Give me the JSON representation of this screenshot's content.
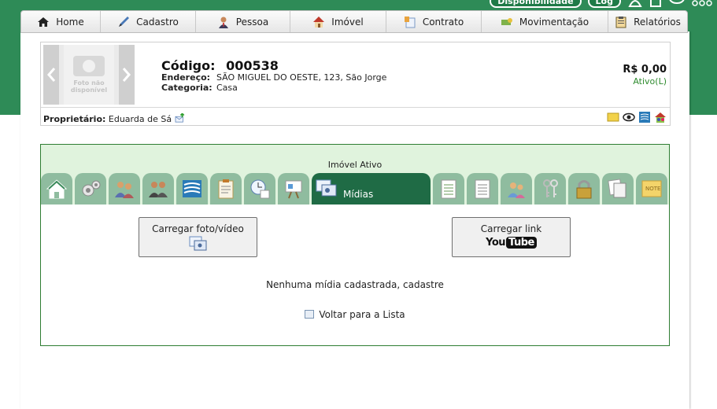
{
  "header": {
    "disponibilidade_label": "Disponibilidade",
    "log_label": "Log"
  },
  "nav": {
    "items": [
      {
        "label": "Home",
        "icon": "home-icon"
      },
      {
        "label": "Cadastro",
        "icon": "pen-icon"
      },
      {
        "label": "Pessoa",
        "icon": "person-icon"
      },
      {
        "label": "Imóvel",
        "icon": "house-icon"
      },
      {
        "label": "Contrato",
        "icon": "contract-icon"
      },
      {
        "label": "Movimentação",
        "icon": "money-icon"
      },
      {
        "label": "Relatórios",
        "icon": "clipboard-icon"
      }
    ]
  },
  "property": {
    "photo_placeholder": "Foto não disponível",
    "codigo_label": "Código:",
    "codigo_value": "000538",
    "endereco_label": "Endereço:",
    "endereco_value": "SÃO MIGUEL DO OESTE, 123, São Jorge",
    "categoria_label": "Categoria:",
    "categoria_value": "Casa",
    "price": "R$ 0,00",
    "status": "Ativo(L)",
    "owner_label": "Proprietário:",
    "owner_value": "Eduarda de Sá"
  },
  "section": {
    "title": "Imóvel Ativo",
    "active_tab_label": "Mídias",
    "upload_media_label": "Carregar foto/vídeo",
    "upload_link_label": "Carregar link",
    "youtube_you": "You",
    "youtube_tube": "Tube",
    "empty_message": "Nenhuma mídia cadastrada, cadastre",
    "back_label": "Voltar para a Lista"
  },
  "colors": {
    "brand_green": "#2e8b57",
    "tab_active": "#1f6b45",
    "tab_inactive": "#8fbc9f",
    "section_bg": "#e0f3dd",
    "status_green": "#2e8b2e"
  }
}
